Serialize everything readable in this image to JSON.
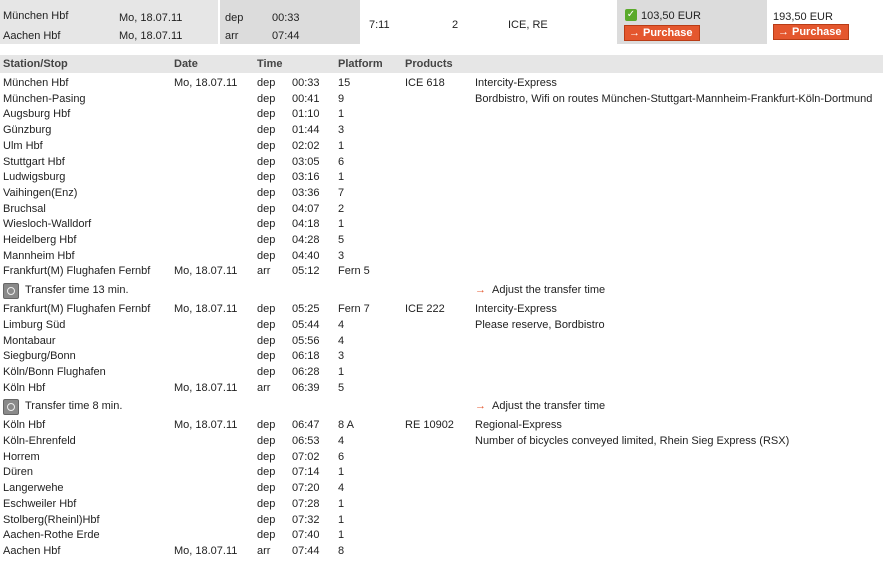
{
  "summary": {
    "origin": "München Hbf",
    "destination": "Aachen Hbf",
    "dep_date": "Mo, 18.07.11",
    "arr_date": "Mo, 18.07.11",
    "dep_label": "dep",
    "arr_label": "arr",
    "dep_time": "00:33",
    "arr_time": "07:44",
    "duration": "7:11",
    "changes": "2",
    "products": "ICE, RE",
    "price_selected": "103,50 EUR",
    "price_other": "193,50 EUR",
    "purchase_label": "Purchase"
  },
  "headers": {
    "station": "Station/Stop",
    "date": "Date",
    "time": "Time",
    "platform": "Platform",
    "products": "Products"
  },
  "segments": [
    {
      "train": "ICE 618",
      "info1": "Intercity-Express",
      "info2": "Bordbistro, Wifi on routes München-Stuttgart-Mannheim-Frankfurt-Köln-Dortmund",
      "stops": [
        {
          "station": "München Hbf",
          "date": "Mo, 18.07.11",
          "type": "dep",
          "time": "00:33",
          "platform": "15"
        },
        {
          "station": "München-Pasing",
          "date": "",
          "type": "dep",
          "time": "00:41",
          "platform": "9"
        },
        {
          "station": "Augsburg Hbf",
          "date": "",
          "type": "dep",
          "time": "01:10",
          "platform": "1"
        },
        {
          "station": "Günzburg",
          "date": "",
          "type": "dep",
          "time": "01:44",
          "platform": "3"
        },
        {
          "station": "Ulm Hbf",
          "date": "",
          "type": "dep",
          "time": "02:02",
          "platform": "1"
        },
        {
          "station": "Stuttgart Hbf",
          "date": "",
          "type": "dep",
          "time": "03:05",
          "platform": "6"
        },
        {
          "station": "Ludwigsburg",
          "date": "",
          "type": "dep",
          "time": "03:16",
          "platform": "1"
        },
        {
          "station": "Vaihingen(Enz)",
          "date": "",
          "type": "dep",
          "time": "03:36",
          "platform": "7"
        },
        {
          "station": "Bruchsal",
          "date": "",
          "type": "dep",
          "time": "04:07",
          "platform": "2"
        },
        {
          "station": "Wiesloch-Walldorf",
          "date": "",
          "type": "dep",
          "time": "04:18",
          "platform": "1"
        },
        {
          "station": "Heidelberg Hbf",
          "date": "",
          "type": "dep",
          "time": "04:28",
          "platform": "5"
        },
        {
          "station": "Mannheim Hbf",
          "date": "",
          "type": "dep",
          "time": "04:40",
          "platform": "3"
        },
        {
          "station": "Frankfurt(M) Flughafen Fernbf",
          "date": "Mo, 18.07.11",
          "type": "arr",
          "time": "05:12",
          "platform": "Fern 5"
        }
      ]
    },
    {
      "train": "ICE 222",
      "info1": "Intercity-Express",
      "info2": "Please reserve, Bordbistro",
      "stops": [
        {
          "station": "Frankfurt(M) Flughafen Fernbf",
          "date": "Mo, 18.07.11",
          "type": "dep",
          "time": "05:25",
          "platform": "Fern 7"
        },
        {
          "station": "Limburg Süd",
          "date": "",
          "type": "dep",
          "time": "05:44",
          "platform": "4"
        },
        {
          "station": "Montabaur",
          "date": "",
          "type": "dep",
          "time": "05:56",
          "platform": "4"
        },
        {
          "station": "Siegburg/Bonn",
          "date": "",
          "type": "dep",
          "time": "06:18",
          "platform": "3"
        },
        {
          "station": "Köln/Bonn Flughafen",
          "date": "",
          "type": "dep",
          "time": "06:28",
          "platform": "1"
        },
        {
          "station": "Köln Hbf",
          "date": "Mo, 18.07.11",
          "type": "arr",
          "time": "06:39",
          "platform": "5"
        }
      ]
    },
    {
      "train": "RE 10902",
      "info1": "Regional-Express",
      "info2": "Number of bicycles conveyed limited, Rhein Sieg Express (RSX)",
      "stops": [
        {
          "station": "Köln Hbf",
          "date": "Mo, 18.07.11",
          "type": "dep",
          "time": "06:47",
          "platform": "8 A"
        },
        {
          "station": "Köln-Ehrenfeld",
          "date": "",
          "type": "dep",
          "time": "06:53",
          "platform": "4"
        },
        {
          "station": "Horrem",
          "date": "",
          "type": "dep",
          "time": "07:02",
          "platform": "6"
        },
        {
          "station": "Düren",
          "date": "",
          "type": "dep",
          "time": "07:14",
          "platform": "1"
        },
        {
          "station": "Langerwehe",
          "date": "",
          "type": "dep",
          "time": "07:20",
          "platform": "4"
        },
        {
          "station": "Eschweiler Hbf",
          "date": "",
          "type": "dep",
          "time": "07:28",
          "platform": "1"
        },
        {
          "station": "Stolberg(Rheinl)Hbf",
          "date": "",
          "type": "dep",
          "time": "07:32",
          "platform": "1"
        },
        {
          "station": "Aachen-Rothe Erde",
          "date": "",
          "type": "dep",
          "time": "07:40",
          "platform": "1"
        },
        {
          "station": "Aachen Hbf",
          "date": "Mo, 18.07.11",
          "type": "arr",
          "time": "07:44",
          "platform": "8"
        }
      ]
    }
  ],
  "transfers": [
    {
      "text": "Transfer time 13 min.",
      "link": "Adjust the transfer time"
    },
    {
      "text": "Transfer time 8 min.",
      "link": "Adjust the transfer time"
    }
  ],
  "colors": {
    "accent": "#e4572e",
    "check": "#5aaa2b",
    "header_bg": "#e6e6e6"
  }
}
